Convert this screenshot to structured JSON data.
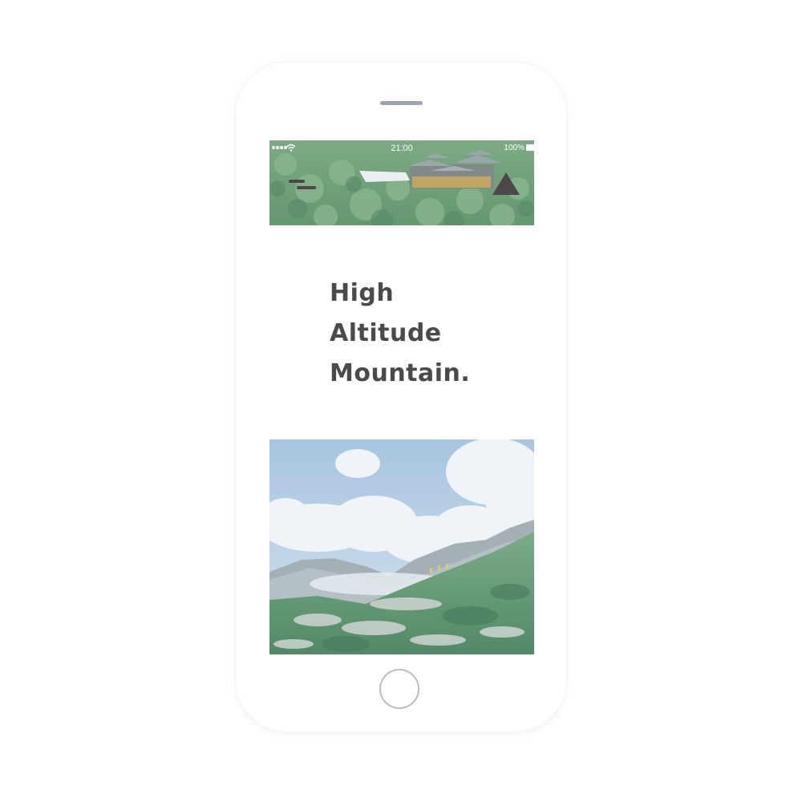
{
  "status_bar": {
    "time": "21:00",
    "battery": "100%"
  },
  "icons": {
    "menu": "menu-icon",
    "logo": "mountain-logo-icon",
    "wifi": "wifi-icon",
    "signal": "signal-icon",
    "battery": "battery-icon"
  },
  "hero": {
    "headline_lines": [
      "High",
      "Altitude",
      "Mountain."
    ]
  },
  "colors": {
    "headline": "#4a4a4a",
    "menu": "#4d4748",
    "logo": "#4d4748",
    "forest": "#5f9a6f",
    "sky": "#b8d0e6"
  }
}
